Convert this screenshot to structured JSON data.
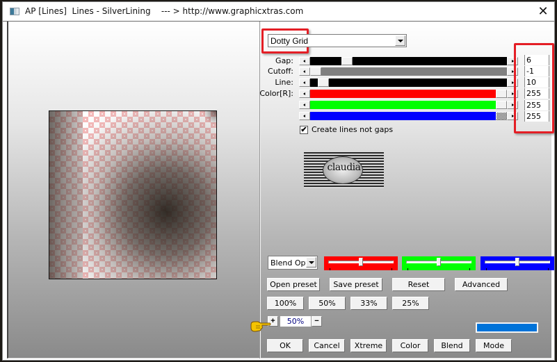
{
  "window": {
    "title": "AP [Lines]  Lines - SilverLining    --- > http://www.graphicxtras.com",
    "close_symbol": "✕"
  },
  "filter": {
    "selected": "Dotty Grid"
  },
  "params": [
    {
      "label": "Gap:",
      "value": "6",
      "bar_color": "#000000",
      "position": 0.17
    },
    {
      "label": "Cutoff:",
      "value": "-1",
      "bar_color": "#808080",
      "position": 0.0
    },
    {
      "label": "Line:",
      "value": "10",
      "bar_color": "#000000",
      "position": 0.04
    },
    {
      "label": "Color[R]:",
      "value": "255",
      "bar_color": "#ff0000",
      "position": 1.0
    },
    {
      "label": "",
      "value": "255",
      "bar_color": "#00ff00",
      "position": 1.0
    },
    {
      "label": "",
      "value": "255",
      "bar_color": "#0000ff",
      "position": 1.0
    }
  ],
  "checkbox": {
    "label": "Create lines not gaps",
    "checked": true,
    "mark": "✔"
  },
  "logo": {
    "text": "claudia"
  },
  "blend": {
    "selected": "Blend Options",
    "sliders": [
      {
        "name": "red",
        "color": "#ff0000",
        "value": 0.5
      },
      {
        "name": "green",
        "color": "#00ff00",
        "value": 0.5
      },
      {
        "name": "blue",
        "color": "#0000ff",
        "value": 0.5
      }
    ]
  },
  "buttons": {
    "open_preset": "Open preset",
    "save_preset": "Save preset",
    "reset": "Reset",
    "advanced": "Advanced",
    "zoom_100": "100%",
    "zoom_50": "50%",
    "zoom_33": "33%",
    "zoom_25": "25%",
    "ok": "OK",
    "cancel": "Cancel",
    "xtreme": "Xtreme",
    "color": "Color",
    "blend": "Blend",
    "mode": "Mode"
  },
  "zoom": {
    "plus": "+",
    "minus": "−",
    "value": "50%"
  },
  "colors": {
    "highlight": "#e41e25",
    "swatch": "#0073d9"
  }
}
